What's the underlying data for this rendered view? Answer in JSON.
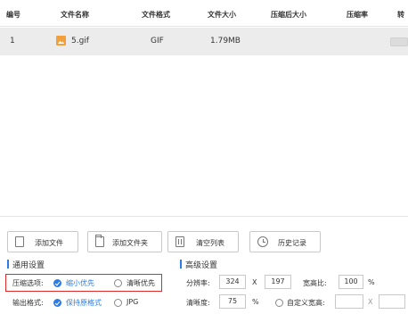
{
  "columns": [
    "编号",
    "文件名称",
    "文件格式",
    "文件大小",
    "压缩后大小",
    "压缩率",
    "转"
  ],
  "file_row": {
    "index": "1",
    "name": "5.gif",
    "format": "GIF",
    "size": "1.79MB",
    "icon": "image-icon",
    "progress": 0
  },
  "toolbar": {
    "add_file": "添加文件",
    "add_folder": "添加文件夹",
    "clear_list": "清空列表",
    "history": "历史记录"
  },
  "general": {
    "title": "通用设置",
    "compress_label": "压缩选项:",
    "compress_options": [
      "缩小优先",
      "清晰优先"
    ],
    "compress_selected": "缩小优先",
    "output_label": "输出格式:",
    "output_options": [
      "保持原格式",
      "JPG"
    ],
    "output_selected": "保持原格式"
  },
  "advanced": {
    "title": "高级设置",
    "resolution_label": "分辨率:",
    "width": "324",
    "x_sep": "X",
    "height": "197",
    "aspect_label": "宽高比:",
    "aspect_value": "100",
    "percent": "%",
    "clarity_label": "清晰度:",
    "clarity_value": "75",
    "custom_label": "自定义宽高:",
    "custom_width": "",
    "custom_height": ""
  },
  "colors": {
    "accent": "#2b7de9",
    "highlight_border": "#e02b2b",
    "row_bg": "#ececec"
  }
}
